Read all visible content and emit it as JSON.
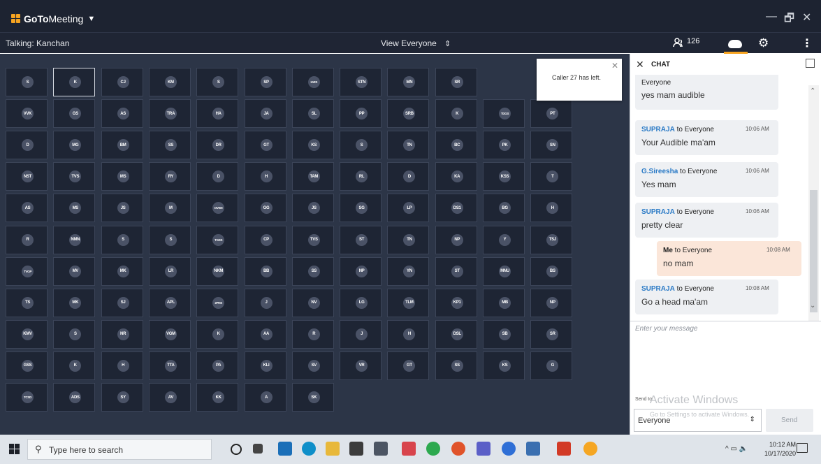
{
  "app": {
    "logo_prefix": "GoTo",
    "logo_suffix": "Meeting",
    "window_controls": {
      "minimize": "—",
      "restore": "🗗",
      "close": "✕"
    }
  },
  "controlbar": {
    "talking": "Talking: Kanchan",
    "view": "View Everyone",
    "attendee_count": "126",
    "chevron_updown": "⌃⌄"
  },
  "grid": {
    "rows": [
      [
        "S",
        "K",
        "CJ",
        "KM",
        "S",
        "SP",
        "IARS",
        "STN",
        "MN",
        "SR",
        "",
        ""
      ],
      [
        "VVK",
        "GS",
        "AS",
        "TRA",
        "HA",
        "JA",
        "SL",
        "PP",
        "SRB",
        "K",
        "TDGS",
        "PT"
      ],
      [
        "D",
        "MG",
        "BM",
        "SS",
        "DR",
        "GT",
        "KS",
        "S",
        "TN",
        "BC",
        "PK",
        "SN"
      ],
      [
        "NST",
        "TVS",
        "MS",
        "RY",
        "D",
        "H",
        "TAM",
        "RL",
        "D",
        "KA",
        "KSS",
        "T"
      ],
      [
        "AS",
        "MS",
        "JS",
        "M",
        "DVSN",
        "GG",
        "JS",
        "SG",
        "LP",
        "DS1",
        "BG",
        "H"
      ],
      [
        "R",
        "NMN",
        "S",
        "S",
        "TGSS",
        "CP",
        "TVS",
        "ST",
        "TN",
        "NP",
        "Y",
        "TSJ"
      ],
      [
        "TVGP",
        "MV",
        "MK",
        "LR",
        "NKM",
        "BB",
        "SS",
        "NP",
        "YN",
        "ST",
        "MNU",
        "BS"
      ],
      [
        "TS",
        "MK",
        "SJ",
        "APL",
        "2PHS",
        "J",
        "NV",
        "LG",
        "TLM",
        "KP1",
        "MB",
        "NP"
      ],
      [
        "KMV",
        "S",
        "NR",
        "VGM",
        "K",
        "AA",
        "R",
        "J",
        "H",
        "DSL",
        "SB",
        "SR"
      ],
      [
        "GSS",
        "K",
        "H",
        "TTA",
        "PA",
        "KLI",
        "SV",
        "VR",
        "GT",
        "SS",
        "KS",
        "G"
      ],
      [
        "TCSD",
        "ADS",
        "SY",
        "AV",
        "KK",
        "A",
        "SK"
      ]
    ],
    "selected": "K",
    "toast": {
      "text": "Caller 27 has left.",
      "close": "✕"
    }
  },
  "chat": {
    "title": "CHAT",
    "close": "✕",
    "messages": [
      {
        "sender": "",
        "to": "Everyone",
        "time": "",
        "text": "yes mam audible",
        "me": false
      },
      {
        "sender": "SUPRAJA",
        "to": " to Everyone",
        "time": "10:06 AM",
        "text": "Your Audible ma'am",
        "me": false
      },
      {
        "sender": "G.Sireesha",
        "to": " to Everyone",
        "time": "10:06 AM",
        "text": "Yes mam",
        "me": false
      },
      {
        "sender": "SUPRAJA",
        "to": " to Everyone",
        "time": "10:06 AM",
        "text": "pretty clear",
        "me": false
      },
      {
        "sender": "Me",
        "to": " to Everyone",
        "time": "10:08 AM",
        "text": "no mam",
        "me": true
      },
      {
        "sender": "SUPRAJA",
        "to": " to Everyone",
        "time": "10:08 AM",
        "text": "Go a head ma'am",
        "me": false
      }
    ],
    "input_placeholder": "Enter your message",
    "send_to_label": "Send to",
    "send_to_value": "Everyone",
    "send_label": "Send",
    "watermark_title": "Activate Windows",
    "watermark_sub": "Go to Settings to activate Windows."
  },
  "taskbar": {
    "search_placeholder": "Type here to search",
    "time": "10:12 AM",
    "date": "10/17/2020",
    "tray": "^ ▭ 🔈"
  }
}
